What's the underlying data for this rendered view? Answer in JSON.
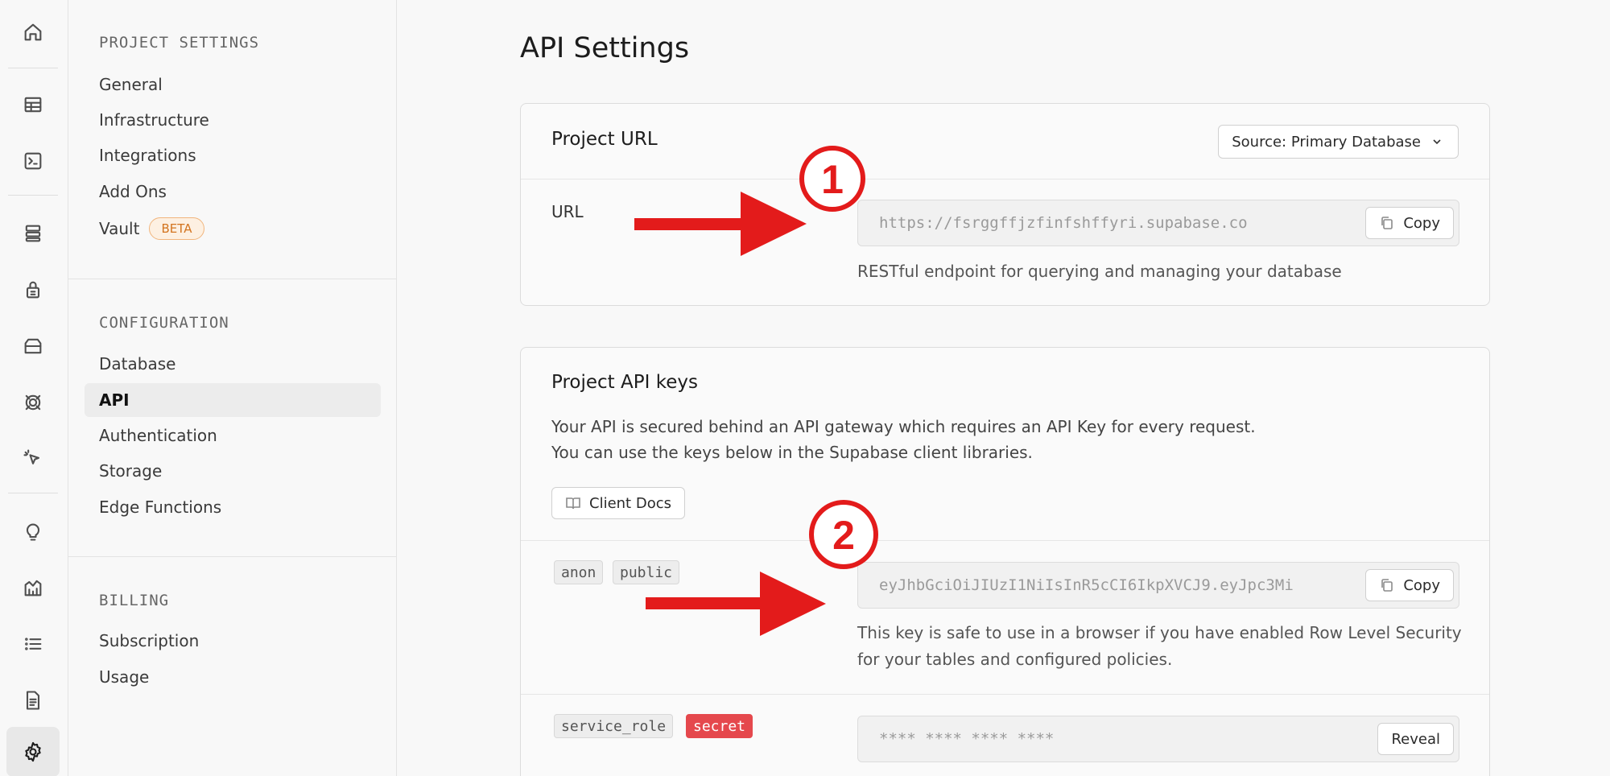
{
  "rail": {
    "icons": [
      "home-icon",
      "table-editor-icon",
      "sql-editor-icon",
      "database-icon",
      "auth-lock-icon",
      "storage-icon",
      "realtime-icon",
      "edge-functions-icon",
      "advisor-bulb-icon",
      "reports-icon",
      "logs-icon",
      "docs-icon",
      "settings-gear-icon"
    ]
  },
  "menu": {
    "project_settings": {
      "title": "PROJECT SETTINGS",
      "items": [
        "General",
        "Infrastructure",
        "Integrations",
        "Add Ons",
        "Vault"
      ],
      "vault_badge": "BETA"
    },
    "configuration": {
      "title": "CONFIGURATION",
      "items": [
        "Database",
        "API",
        "Authentication",
        "Storage",
        "Edge Functions"
      ],
      "active": "API"
    },
    "billing": {
      "title": "BILLING",
      "items": [
        "Subscription",
        "Usage"
      ]
    }
  },
  "main": {
    "title": "API Settings",
    "project_url": {
      "title": "Project URL",
      "source_label": "Source: Primary Database",
      "url_label": "URL",
      "url_value": "https://fsrggffjzfinfshffyri.supabase.co",
      "copy_label": "Copy",
      "help": "RESTful endpoint for querying and managing your database"
    },
    "api_keys": {
      "title": "Project API keys",
      "desc_line1": "Your API is secured behind an API gateway which requires an API Key for every request.",
      "desc_line2": "You can use the keys below in the Supabase client libraries.",
      "client_docs_label": "Client Docs",
      "anon": {
        "tag1": "anon",
        "tag2": "public",
        "value": "eyJhbGciOiJIUzI1NiIsInR5cCI6IkpXVCJ9.eyJpc3Mi",
        "copy_label": "Copy",
        "help_line1": "This key is safe to use in a browser if you have enabled Row Level Security",
        "help_line2": "for your tables and configured policies."
      },
      "service_role": {
        "tag1": "service_role",
        "tag2": "secret",
        "value": "**** **** **** ****",
        "reveal_label": "Reveal"
      }
    }
  },
  "annotations": {
    "marker1": "1",
    "marker2": "2",
    "color": "#e31b1b"
  }
}
